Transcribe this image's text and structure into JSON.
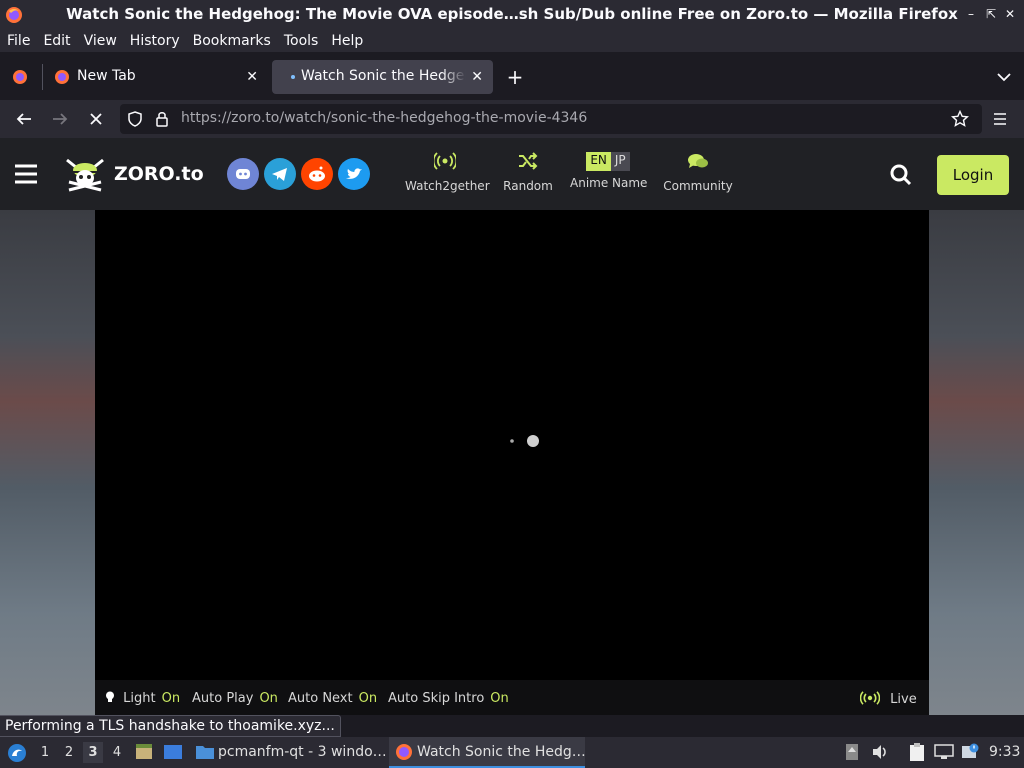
{
  "window": {
    "title": "Watch Sonic the Hedgehog: The Movie OVA episode…sh Sub/Dub online Free on Zoro.to — Mozilla Firefox"
  },
  "menubar": [
    "File",
    "Edit",
    "View",
    "History",
    "Bookmarks",
    "Tools",
    "Help"
  ],
  "tabs": [
    {
      "label": "New Tab"
    },
    {
      "label": "Watch Sonic the Hedgeh"
    }
  ],
  "urlbar": {
    "url_host": "https://zoro.to",
    "url_path": "/watch/sonic-the-hedgehog-the-movie-4346"
  },
  "site": {
    "logo": "ZORO.to",
    "nav": [
      {
        "label": "Watch2gether",
        "icon": "broadcast-icon"
      },
      {
        "label": "Random",
        "icon": "shuffle-icon"
      },
      {
        "label": "Anime Name",
        "icon": "language-toggle-icon"
      },
      {
        "label": "Community",
        "icon": "chat-icon"
      }
    ],
    "lang": {
      "en": "EN",
      "jp": "JP"
    },
    "login": "Login",
    "accent": "#cae962"
  },
  "player": {
    "controls": [
      {
        "label": "Light",
        "state": "On"
      },
      {
        "label": "Auto Play",
        "state": "On"
      },
      {
        "label": "Auto Next",
        "state": "On"
      },
      {
        "label": "Auto Skip Intro",
        "state": "On"
      }
    ],
    "live": "Live"
  },
  "statusbar": "Performing a TLS handshake to thoamike.xyz...",
  "taskbar": {
    "workspaces": [
      "1",
      "2",
      "3",
      "4"
    ],
    "active_workspace": "3",
    "apps": [
      {
        "label": "pcmanfm-qt - 3 windo…"
      },
      {
        "label": "Watch Sonic the Hedg…"
      }
    ],
    "clock": "9:33"
  }
}
